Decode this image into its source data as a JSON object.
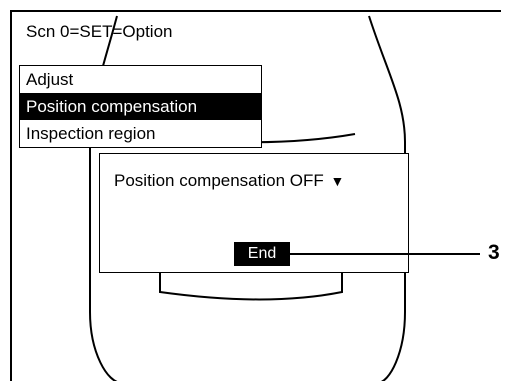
{
  "scene_title": "Scn 0=SET=Option",
  "menu": {
    "items": [
      {
        "label": "Adjust",
        "selected": false
      },
      {
        "label": "Position compensation",
        "selected": true
      },
      {
        "label": "Inspection region",
        "selected": false
      }
    ]
  },
  "dialog": {
    "option_label": "Position compensation OFF",
    "dropdown_arrow": "▼",
    "end_label": "End"
  },
  "callout": {
    "number": "3"
  }
}
